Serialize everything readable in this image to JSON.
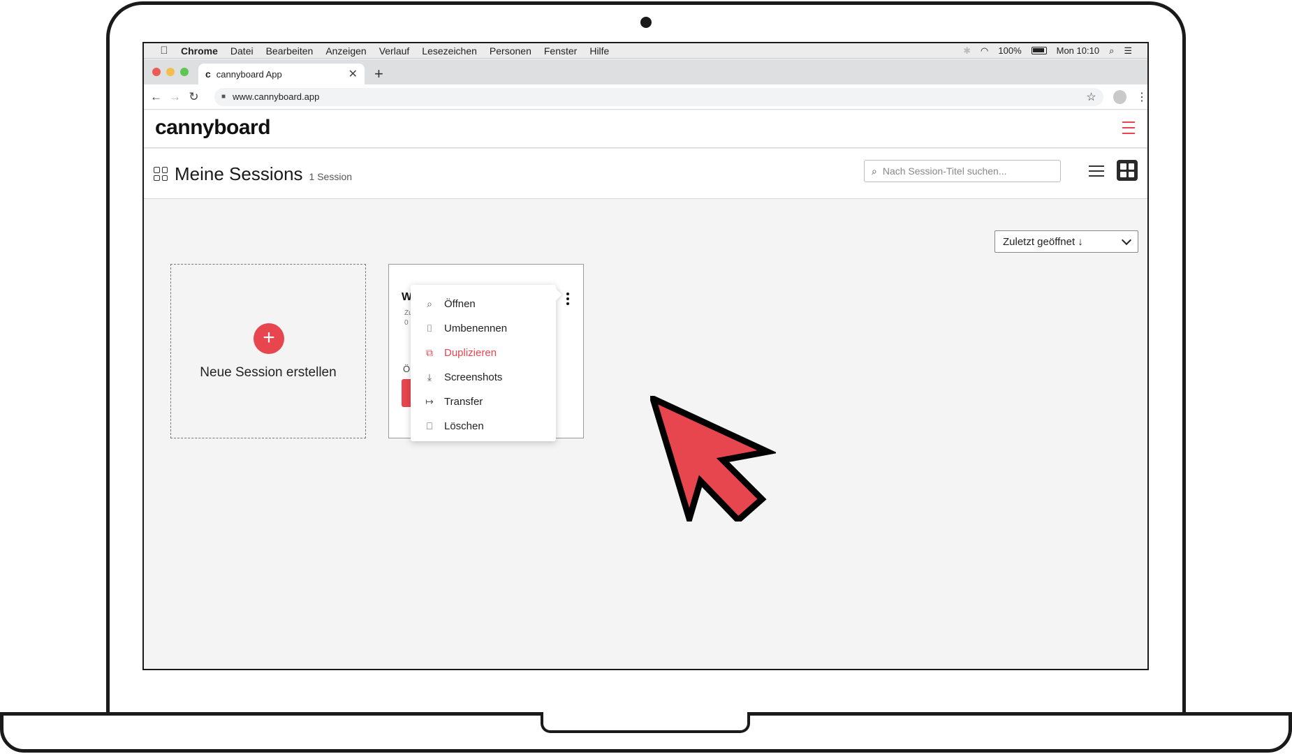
{
  "menubar": {
    "apple": "",
    "items": [
      "Chrome",
      "Datei",
      "Bearbeiten",
      "Anzeigen",
      "Verlauf",
      "Lesezeichen",
      "Personen",
      "Fenster",
      "Hilfe"
    ],
    "battery": "100%",
    "clock": "Mon 10:10"
  },
  "browser": {
    "tab_title": "cannyboard App",
    "tab_favicon": "c",
    "url": "www.cannyboard.app"
  },
  "app": {
    "logo": "cannyboard",
    "accent": "#e8464f"
  },
  "page": {
    "title": "Meine Sessions",
    "count": "1 Session",
    "search_placeholder": "Nach Session-Titel suchen...",
    "sort_label": "Zuletzt geöffnet ↓"
  },
  "new_session": {
    "label": "Neue Session erstellen"
  },
  "session_card": {
    "title_fragment": "W",
    "meta1_fragment": "Zu",
    "meta2_fragment": "0",
    "open_fragment": "Ö"
  },
  "context_menu": {
    "items": [
      {
        "label": "Öffnen",
        "icon": "search-icon"
      },
      {
        "label": "Umbenennen",
        "icon": "rename-icon"
      },
      {
        "label": "Duplizieren",
        "icon": "duplicate-icon"
      },
      {
        "label": "Screenshots",
        "icon": "download-icon"
      },
      {
        "label": "Transfer",
        "icon": "transfer-icon"
      },
      {
        "label": "Löschen",
        "icon": "trash-icon"
      }
    ]
  }
}
